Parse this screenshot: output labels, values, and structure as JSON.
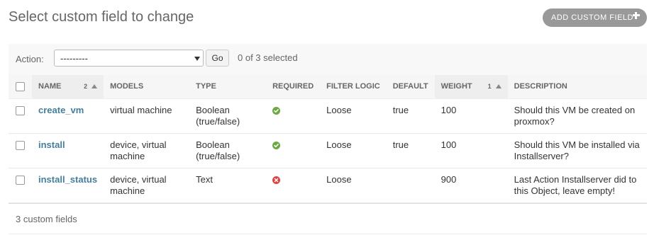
{
  "page": {
    "title": "Select custom field to change",
    "add_button_label": "ADD CUSTOM FIELD"
  },
  "actions": {
    "label": "Action:",
    "selected_value": "---------",
    "go_label": "Go",
    "selection_status": "0 of 3 selected"
  },
  "table": {
    "columns": [
      {
        "label": "NAME",
        "sort_priority": "2",
        "sort_direction": "ascending"
      },
      {
        "label": "MODELS"
      },
      {
        "label": "TYPE"
      },
      {
        "label": "REQUIRED"
      },
      {
        "label": "FILTER LOGIC"
      },
      {
        "label": "DEFAULT"
      },
      {
        "label": "WEIGHT",
        "sort_priority": "1",
        "sort_direction": "ascending"
      },
      {
        "label": "DESCRIPTION"
      }
    ],
    "rows": [
      {
        "name": "create_vm",
        "models_line1": "virtual machine",
        "models_line2": "",
        "type_line1": "Boolean",
        "type_line2": "(true/false)",
        "required": true,
        "required_icon": "check-circle-icon",
        "filter_logic": "Loose",
        "default": "true",
        "weight": "100",
        "description_line1": "Should this VM be created on",
        "description_line2": "proxmox?"
      },
      {
        "name": "install",
        "models_line1": "device, virtual",
        "models_line2": "machine",
        "type_line1": "Boolean",
        "type_line2": "(true/false)",
        "required": true,
        "required_icon": "check-circle-icon",
        "filter_logic": "Loose",
        "default": "true",
        "weight": "100",
        "description_line1": "Should this VM be installed via",
        "description_line2": "Installserver?"
      },
      {
        "name": "install_status",
        "models_line1": "device, virtual",
        "models_line2": "machine",
        "type_line1": "Text",
        "type_line2": "",
        "required": false,
        "required_icon": "x-circle-icon",
        "filter_logic": "Loose",
        "default": "",
        "weight": "900",
        "description_line1": "Last Action Installserver did to",
        "description_line2": "this Object, leave empty!"
      }
    ]
  },
  "paginator": {
    "count_text": "3 custom fields"
  },
  "colors": {
    "link": "#447e9b",
    "status_yes": "#6ca843",
    "status_no": "#dd4646",
    "button_grey": "#999999"
  }
}
